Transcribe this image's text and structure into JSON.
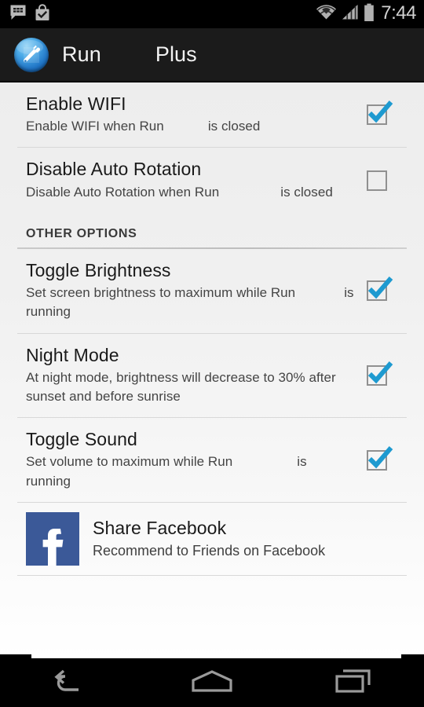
{
  "status_bar": {
    "icons": [
      "bbm-chat-icon",
      "play-store-update-icon"
    ],
    "wifi_icon": "wifi-icon",
    "signal_icon": "cellular-signal-icon",
    "battery_icon": "battery-icon",
    "clock": "7:44"
  },
  "action_bar": {
    "app_icon": "app-wrench-icon",
    "title_primary": "Run",
    "title_secondary": "Plus"
  },
  "preferences": [
    {
      "title": "Enable WIFI",
      "summary_start": "Enable WIFI when Run",
      "summary_end": "is closed",
      "checked": true
    },
    {
      "title": "Disable Auto Rotation",
      "summary_start": "Disable Auto Rotation when Run",
      "summary_end": "is closed",
      "checked": false
    }
  ],
  "section": {
    "header": "OTHER OPTIONS"
  },
  "other_options": [
    {
      "title": "Toggle Brightness",
      "summary_start": "Set screen brightness to maximum while Run",
      "summary_end": "is running",
      "checked": true
    },
    {
      "title": "Night Mode",
      "summary_start": "At night mode, brightness will decrease to 30% after sunset and before sunrise",
      "summary_end": "",
      "checked": true
    },
    {
      "title": "Toggle Sound",
      "summary_start": "Set volume to maximum while Run",
      "summary_end": "is running",
      "checked": true
    }
  ],
  "facebook": {
    "icon": "facebook-icon",
    "title": "Share Facebook",
    "summary": "Recommend to Friends on Facebook"
  },
  "nav_bar": {
    "back": "back-icon",
    "home": "home-icon",
    "recents": "recents-icon"
  },
  "colors": {
    "accent_checkbox": "#1e9ad0",
    "facebook_blue": "#3b5998",
    "action_bar_bg": "#1b1b1b",
    "status_bar_bg": "#000000"
  }
}
